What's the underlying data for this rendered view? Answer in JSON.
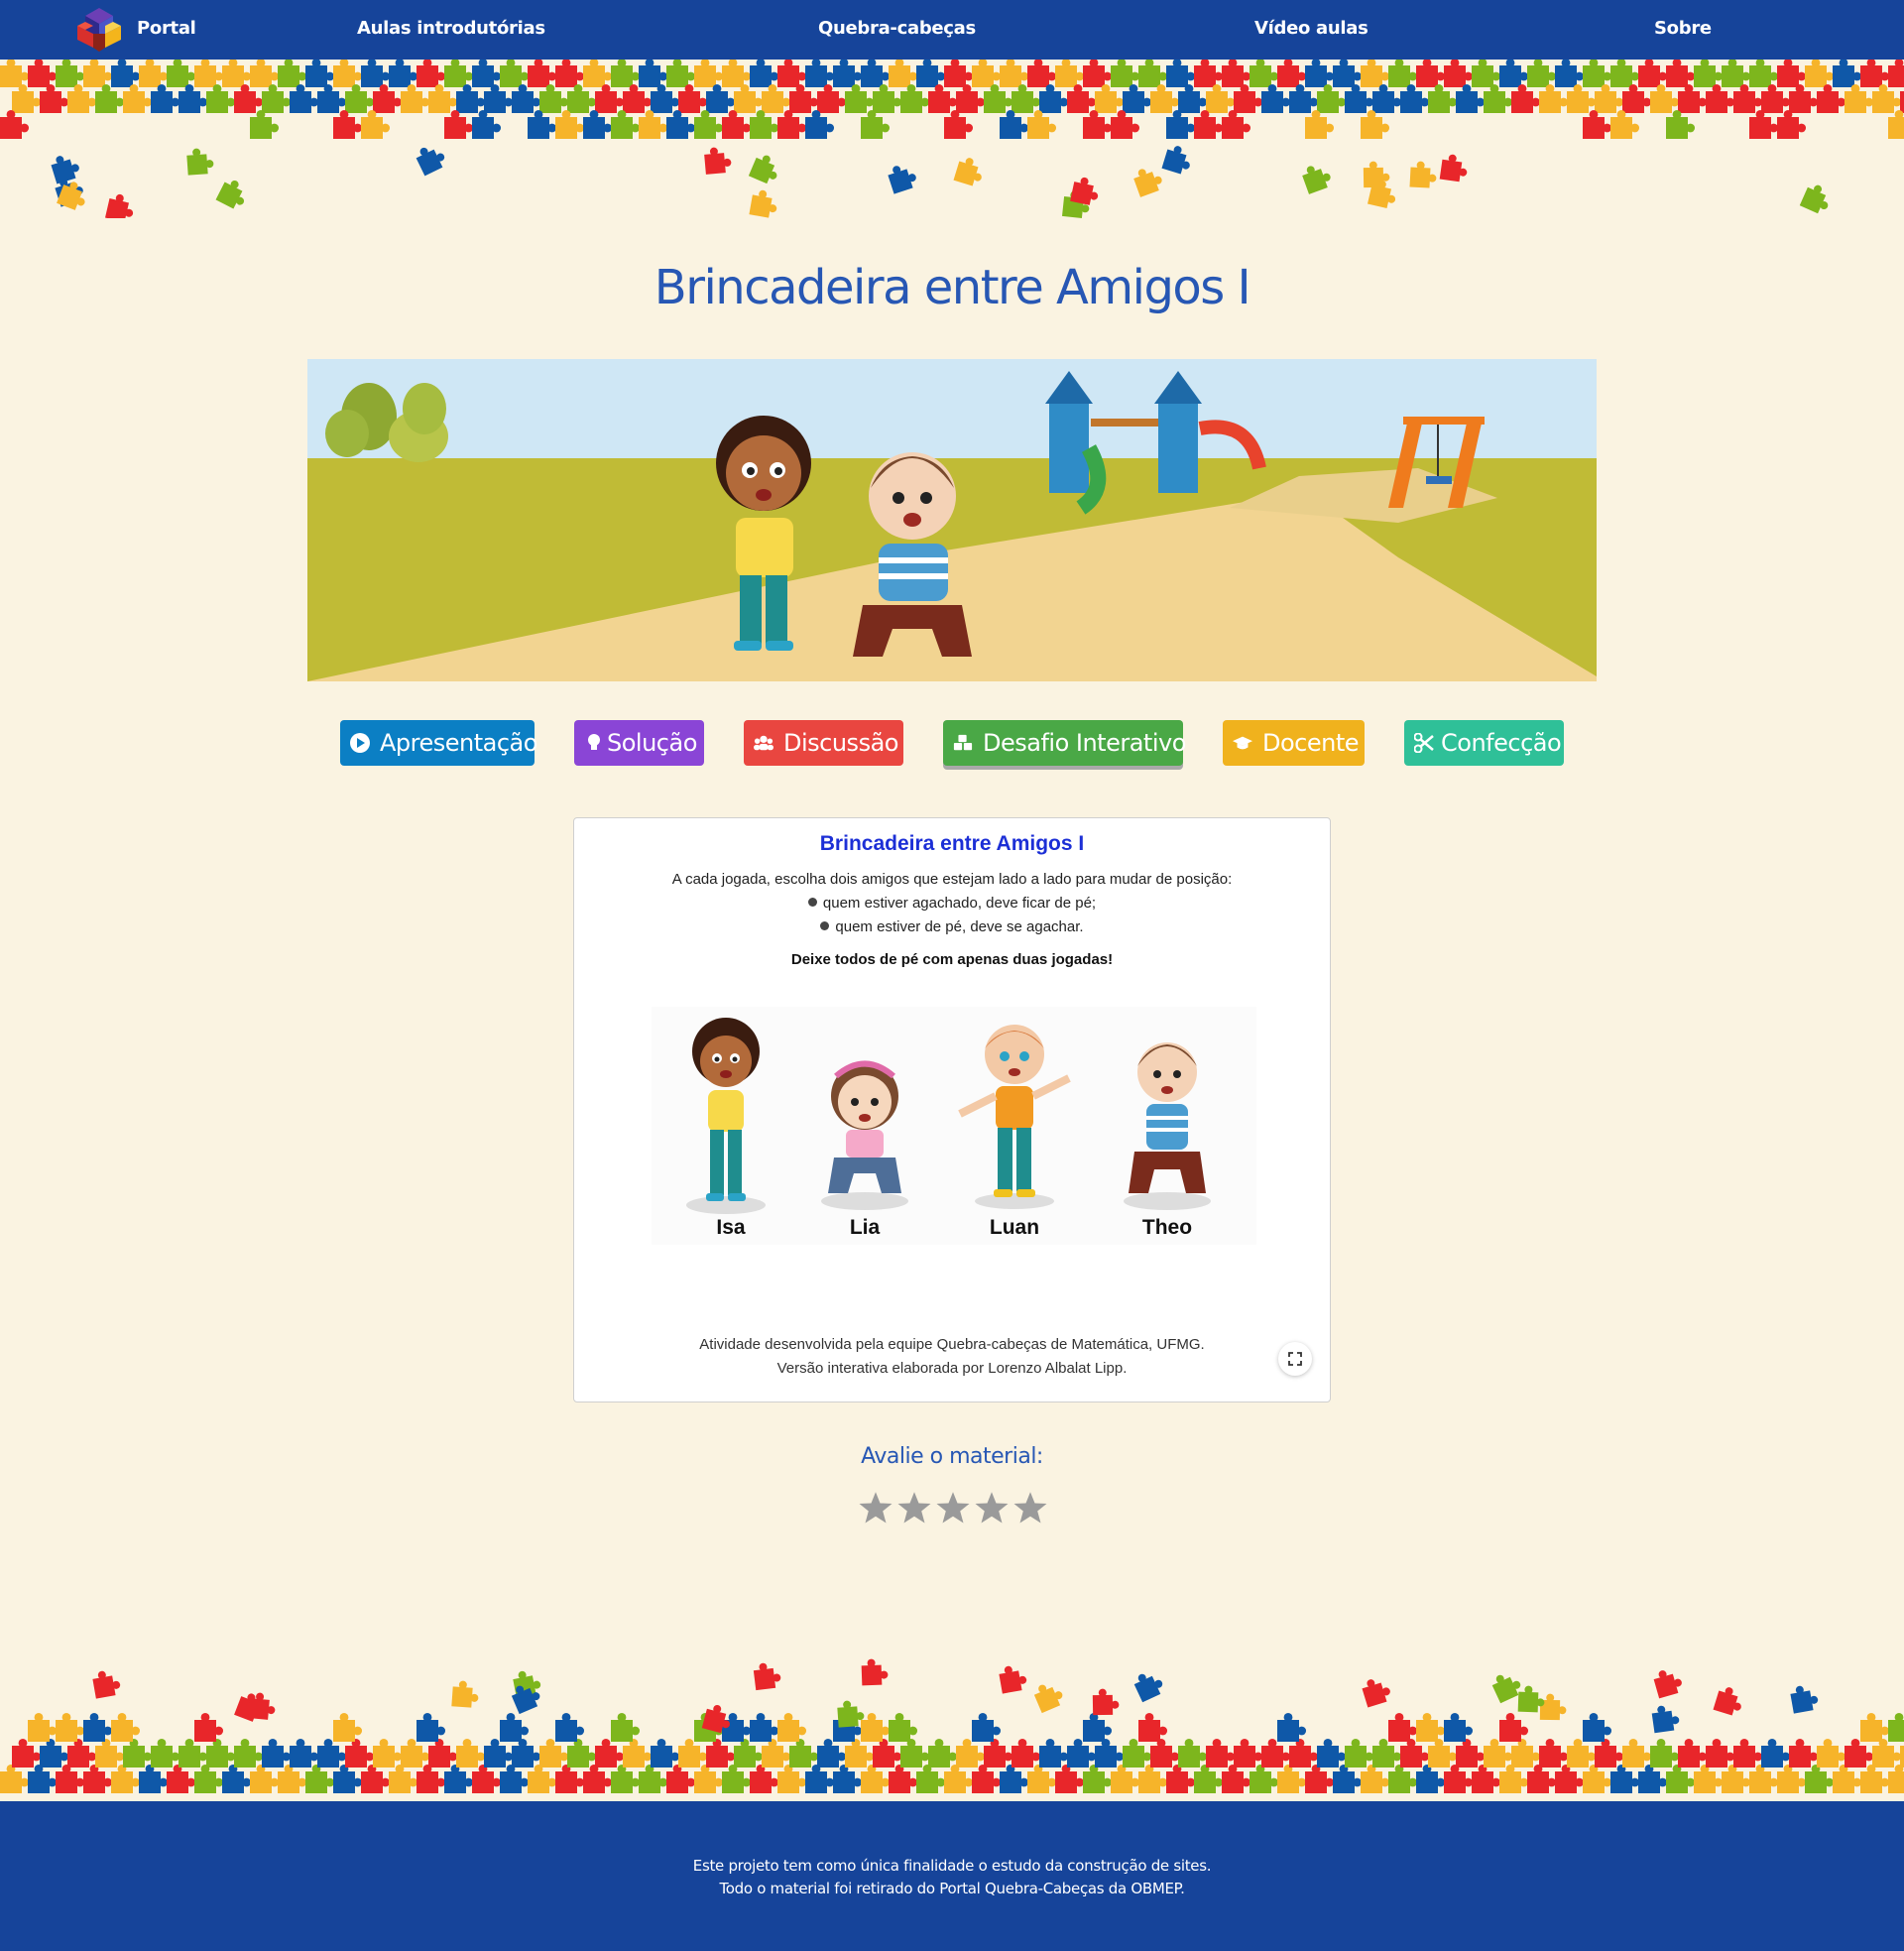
{
  "nav": {
    "brand": "Portal",
    "links": [
      "Aulas introdutórias",
      "Quebra-cabeças",
      "Vídeo aulas",
      "Sobre"
    ]
  },
  "page_title": "Brincadeira entre Amigos I",
  "tabs": [
    {
      "label": "Apresentação",
      "color": "#0b7fc4",
      "icon": "play-circle-icon"
    },
    {
      "label": "Solução",
      "color": "#8a45d6",
      "icon": "lightbulb-icon"
    },
    {
      "label": "Discussão",
      "color": "#e94640",
      "icon": "users-icon"
    },
    {
      "label": "Desafio Interativo",
      "color": "#4aa846",
      "icon": "cubes-icon",
      "active": true
    },
    {
      "label": "Docente",
      "color": "#f0b21d",
      "icon": "graduation-cap-icon"
    },
    {
      "label": "Confecção",
      "color": "#2fc098",
      "icon": "scissors-icon"
    }
  ],
  "activity": {
    "title": "Brincadeira entre Amigos I",
    "intro": "A cada jogada, escolha dois amigos que estejam lado a lado para mudar de posição:",
    "rules": [
      "quem estiver agachado, deve ficar de pé;",
      "quem estiver de pé, deve se agachar."
    ],
    "goal": "Deixe todos de pé com apenas duas jogadas!",
    "kids": [
      {
        "name": "Isa",
        "pose": "standing"
      },
      {
        "name": "Lia",
        "pose": "crouching"
      },
      {
        "name": "Luan",
        "pose": "standing"
      },
      {
        "name": "Theo",
        "pose": "crouching"
      }
    ],
    "credits": [
      "Atividade desenvolvida pela equipe Quebra-cabeças de Matemática, UFMG.",
      "Versão interativa elaborada por Lorenzo Albalat Lipp."
    ],
    "fullscreen_icon": "expand-icon"
  },
  "rating": {
    "label": "Avalie o material:",
    "stars": 5,
    "value": 0
  },
  "footer": {
    "lines": [
      "Este projeto tem como única finalidade o estudo da construção de sites.",
      "Todo o material foi retirado do Portal Quebra-Cabeças da OBMEP."
    ]
  },
  "colors": {
    "nav_bg": "#16449a",
    "page_bg": "#faf3e1",
    "title": "#2757b4",
    "puzzle": [
      "#e8262a",
      "#f6b42a",
      "#0f58a8",
      "#7db61d"
    ]
  }
}
